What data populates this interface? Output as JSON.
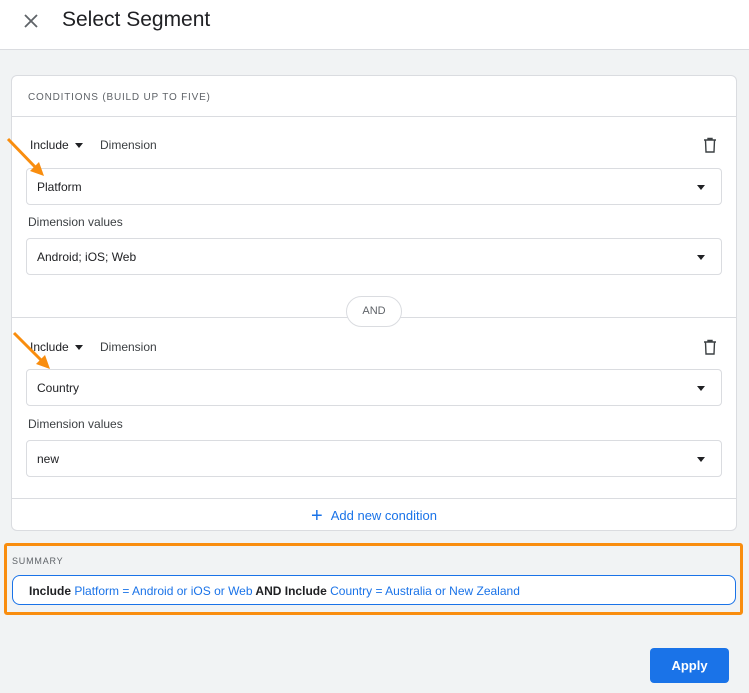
{
  "header": {
    "title": "Select Segment",
    "close_icon": "close-icon"
  },
  "conditions": {
    "heading": "CONDITIONS (BUILD UP TO FIVE)",
    "items": [
      {
        "include_label": "Include",
        "type_label": "Dimension",
        "dimension": "Platform",
        "values_label": "Dimension values",
        "values": "Android; iOS; Web"
      },
      {
        "include_label": "Include",
        "type_label": "Dimension",
        "dimension": "Country",
        "values_label": "Dimension values",
        "values": "new"
      }
    ],
    "joiner": "AND",
    "add_label": "Add new condition"
  },
  "summary": {
    "label": "SUMMARY",
    "parts": [
      {
        "text": "Include ",
        "style": "bold"
      },
      {
        "text": "Platform = Android or iOS or Web",
        "style": "value"
      },
      {
        "text": " AND Include ",
        "style": "bold"
      },
      {
        "text": "Country = Australia or New Zealand",
        "style": "value"
      }
    ]
  },
  "apply_label": "Apply",
  "colors": {
    "accent": "#1a73e8",
    "highlight": "#f98d0e"
  }
}
